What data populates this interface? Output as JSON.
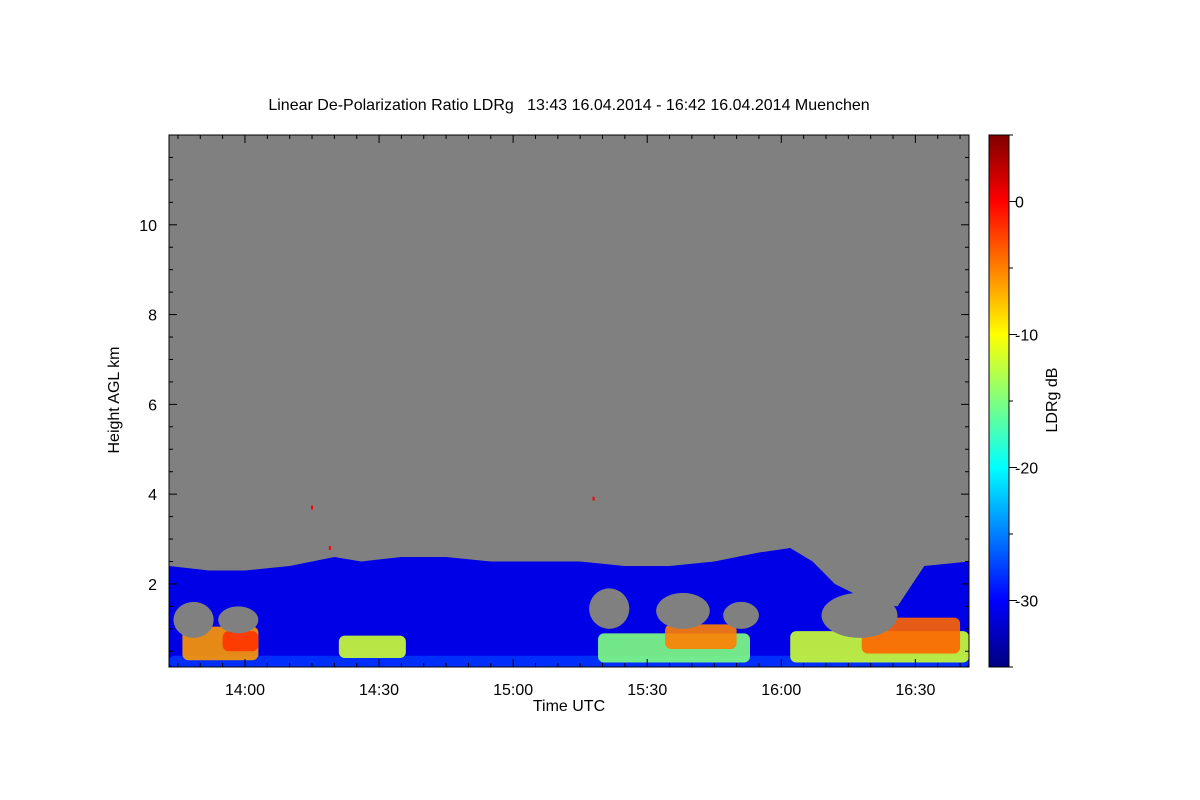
{
  "chart_data": {
    "type": "heatmap",
    "title": "Linear De-Polarization Ratio LDRg   13:43 16.04.2014 - 16:42 16.04.2014 Muenchen",
    "xlabel": "Time UTC",
    "ylabel": "Height AGL km",
    "colorbar_label": "LDRg dB",
    "x_range": [
      "13:43",
      "16:42"
    ],
    "xlim_minutes_utc": [
      823,
      1002
    ],
    "x_ticks": [
      {
        "label": "14:00",
        "value": 840
      },
      {
        "label": "14:30",
        "value": 870
      },
      {
        "label": "15:00",
        "value": 900
      },
      {
        "label": "15:30",
        "value": 930
      },
      {
        "label": "16:00",
        "value": 960
      },
      {
        "label": "16:30",
        "value": 990
      }
    ],
    "ylim": [
      0.15,
      12.0
    ],
    "y_ticks": [
      2,
      4,
      6,
      8,
      10
    ],
    "colorbar_range": [
      -35,
      5
    ],
    "colorbar_ticks": [
      0,
      -10,
      -20,
      -30
    ],
    "colormap": "jet",
    "no_signal_color": "#808080",
    "signal_top_km": [
      {
        "time": 823,
        "height": 2.4
      },
      {
        "time": 832,
        "height": 2.3
      },
      {
        "time": 840,
        "height": 2.3
      },
      {
        "time": 850,
        "height": 2.4
      },
      {
        "time": 860,
        "height": 2.6
      },
      {
        "time": 866,
        "height": 2.5
      },
      {
        "time": 875,
        "height": 2.6
      },
      {
        "time": 885,
        "height": 2.6
      },
      {
        "time": 895,
        "height": 2.5
      },
      {
        "time": 905,
        "height": 2.5
      },
      {
        "time": 915,
        "height": 2.5
      },
      {
        "time": 925,
        "height": 2.4
      },
      {
        "time": 935,
        "height": 2.4
      },
      {
        "time": 945,
        "height": 2.5
      },
      {
        "time": 955,
        "height": 2.7
      },
      {
        "time": 962,
        "height": 2.8
      },
      {
        "time": 967,
        "height": 2.5
      },
      {
        "time": 972,
        "height": 2.0
      },
      {
        "time": 980,
        "height": 1.6
      },
      {
        "time": 986,
        "height": 1.5
      },
      {
        "time": 992,
        "height": 2.4
      },
      {
        "time": 1002,
        "height": 2.5
      }
    ],
    "features": [
      {
        "kind": "aerosol_layer",
        "t_start": 823,
        "t_end": 1002,
        "h_bottom": 0.15,
        "h_top": 0.4,
        "ldr_db": -28
      },
      {
        "kind": "depolarizing_layer",
        "t_start": 826,
        "t_end": 843,
        "h_bottom": 0.3,
        "h_top": 1.05,
        "ldr_db": -6
      },
      {
        "kind": "depolarizing_layer",
        "t_start": 835,
        "t_end": 843,
        "h_bottom": 0.5,
        "h_top": 0.95,
        "ldr_db": -2
      },
      {
        "kind": "depolarizing_layer",
        "t_start": 861,
        "t_end": 876,
        "h_bottom": 0.35,
        "h_top": 0.85,
        "ldr_db": -12
      },
      {
        "kind": "depolarizing_layer",
        "t_start": 919,
        "t_end": 953,
        "h_bottom": 0.25,
        "h_top": 0.9,
        "ldr_db": -15
      },
      {
        "kind": "depolarizing_layer",
        "t_start": 934,
        "t_end": 950,
        "h_bottom": 0.55,
        "h_top": 1.1,
        "ldr_db": -5
      },
      {
        "kind": "depolarizing_layer",
        "t_start": 962,
        "t_end": 1002,
        "h_bottom": 0.25,
        "h_top": 0.95,
        "ldr_db": -12
      },
      {
        "kind": "depolarizing_layer",
        "t_start": 978,
        "t_end": 1000,
        "h_bottom": 0.45,
        "h_top": 1.25,
        "ldr_db": -4
      }
    ],
    "no_signal_gaps": [
      {
        "t_start": 824,
        "t_end": 833,
        "h_bottom": 0.8,
        "h_top": 1.6
      },
      {
        "t_start": 834,
        "t_end": 843,
        "h_bottom": 0.9,
        "h_top": 1.5
      },
      {
        "t_start": 917,
        "t_end": 926,
        "h_bottom": 1.0,
        "h_top": 1.9
      },
      {
        "t_start": 932,
        "t_end": 944,
        "h_bottom": 1.0,
        "h_top": 1.8
      },
      {
        "t_start": 947,
        "t_end": 955,
        "h_bottom": 1.0,
        "h_top": 1.6
      },
      {
        "t_start": 969,
        "t_end": 986,
        "h_bottom": 0.8,
        "h_top": 1.8
      }
    ],
    "isolated_points": [
      {
        "time": 855,
        "height": 3.7,
        "ldr_db": 0
      },
      {
        "time": 859,
        "height": 2.8,
        "ldr_db": 0
      },
      {
        "time": 918,
        "height": 3.9,
        "ldr_db": 0
      }
    ]
  }
}
